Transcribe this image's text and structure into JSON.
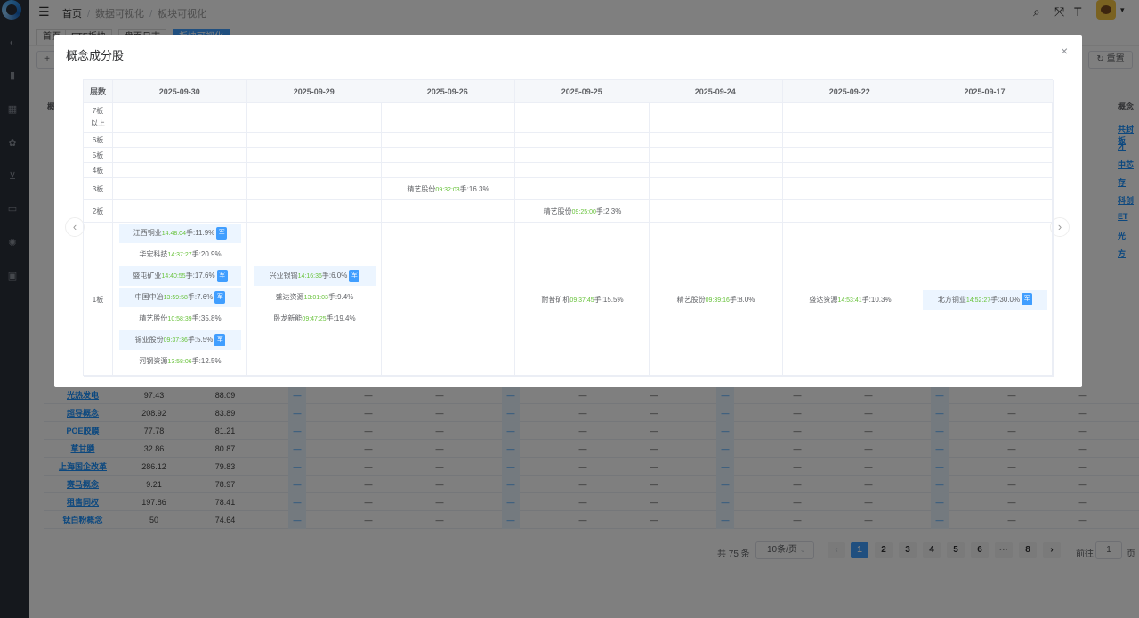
{
  "topbar": {
    "breadcrumb": [
      "首页",
      "数据可视化",
      "板块可视化"
    ]
  },
  "tags": [
    "首页",
    "ETF板块",
    "盘面日志",
    "板块可视化"
  ],
  "toolbar": {
    "add_label": "+",
    "reset_label": "重置"
  },
  "background_table": {
    "header_left": "概",
    "header_right": "概念",
    "rows": [
      {
        "name": "光热发电",
        "v1": "97.43",
        "v2": "88.09"
      },
      {
        "name": "超导概念",
        "v1": "208.92",
        "v2": "83.89"
      },
      {
        "name": "POE胶膜",
        "v1": "77.78",
        "v2": "81.21"
      },
      {
        "name": "草甘膦",
        "v1": "32.86",
        "v2": "80.87"
      },
      {
        "name": "上海国企改革",
        "v1": "286.12",
        "v2": "79.83"
      },
      {
        "name": "赛马概念",
        "v1": "9.21",
        "v2": "78.97"
      },
      {
        "name": "租售同权",
        "v1": "197.86",
        "v2": "78.41"
      },
      {
        "name": "钛白粉概念",
        "v1": "50",
        "v2": "74.64"
      }
    ],
    "right_links": [
      "共封板",
      "才",
      "中芯",
      "存",
      "科创",
      "ET",
      "光",
      "方"
    ],
    "dash": "—"
  },
  "pagination": {
    "total": "共 75 条",
    "page_size": "10条/页",
    "pages": [
      "1",
      "2",
      "3",
      "4",
      "5",
      "6",
      "···",
      "8"
    ],
    "current": "1",
    "goto_label": "前往",
    "goto_value": "1",
    "goto_suffix": "页"
  },
  "dialog": {
    "title": "概念成分股",
    "close": "×",
    "prev": "‹",
    "next": "›",
    "layer_header": "层数",
    "dates": [
      "2025-09-30",
      "2025-09-29",
      "2025-09-26",
      "2025-09-25",
      "2025-09-24",
      "2025-09-22",
      "2025-09-17"
    ],
    "layers": [
      "7板以上",
      "6板",
      "5板",
      "4板",
      "3板",
      "2板",
      "1板"
    ],
    "badge_text": "军",
    "cells": {
      "3板": [
        null,
        null,
        [
          {
            "name": "精艺股份",
            "time": "09:32:03",
            "ratio": "手:16.3%"
          }
        ],
        null,
        null,
        null,
        null
      ],
      "2板": [
        null,
        null,
        null,
        [
          {
            "name": "精艺股份",
            "time": "09:25:00",
            "ratio": "手:2.3%"
          }
        ],
        null,
        null,
        null
      ],
      "1板": [
        [
          {
            "name": "江西铜业",
            "time": "14:48:04",
            "ratio": "手:11.9%",
            "badge": true
          },
          {
            "name": "华宏科技",
            "time": "14:37:27",
            "ratio": "手:20.9%"
          },
          {
            "name": "盛屯矿业",
            "time": "14:40:55",
            "ratio": "手:17.6%",
            "badge": true
          },
          {
            "name": "中国中冶",
            "time": "13:59:58",
            "ratio": "手:7.6%",
            "badge": true
          },
          {
            "name": "精艺股份",
            "time": "10:58:39",
            "ratio": "手:35.8%"
          },
          {
            "name": "锡业股份",
            "time": "09:37:36",
            "ratio": "手:5.5%",
            "badge": true
          },
          {
            "name": "河钢资源",
            "time": "13:58:06",
            "ratio": "手:12.5%"
          }
        ],
        [
          {
            "name": "兴业银锡",
            "time": "14:16:36",
            "ratio": "手:6.0%",
            "badge": true
          },
          {
            "name": "盛达资源",
            "time": "13:01:03",
            "ratio": "手:9.4%"
          },
          {
            "name": "卧龙新能",
            "time": "09:47:25",
            "ratio": "手:19.4%"
          }
        ],
        null,
        [
          {
            "name": "耐普矿机",
            "time": "09:37:45",
            "ratio": "手:15.5%"
          }
        ],
        [
          {
            "name": "精艺股份",
            "time": "09:39:16",
            "ratio": "手:8.0%"
          }
        ],
        [
          {
            "name": "盛达资源",
            "time": "14:53:41",
            "ratio": "手:10.3%"
          }
        ],
        [
          {
            "name": "北方铜业",
            "time": "14:52:27",
            "ratio": "手:30.0%",
            "badge": true
          }
        ]
      ]
    }
  }
}
